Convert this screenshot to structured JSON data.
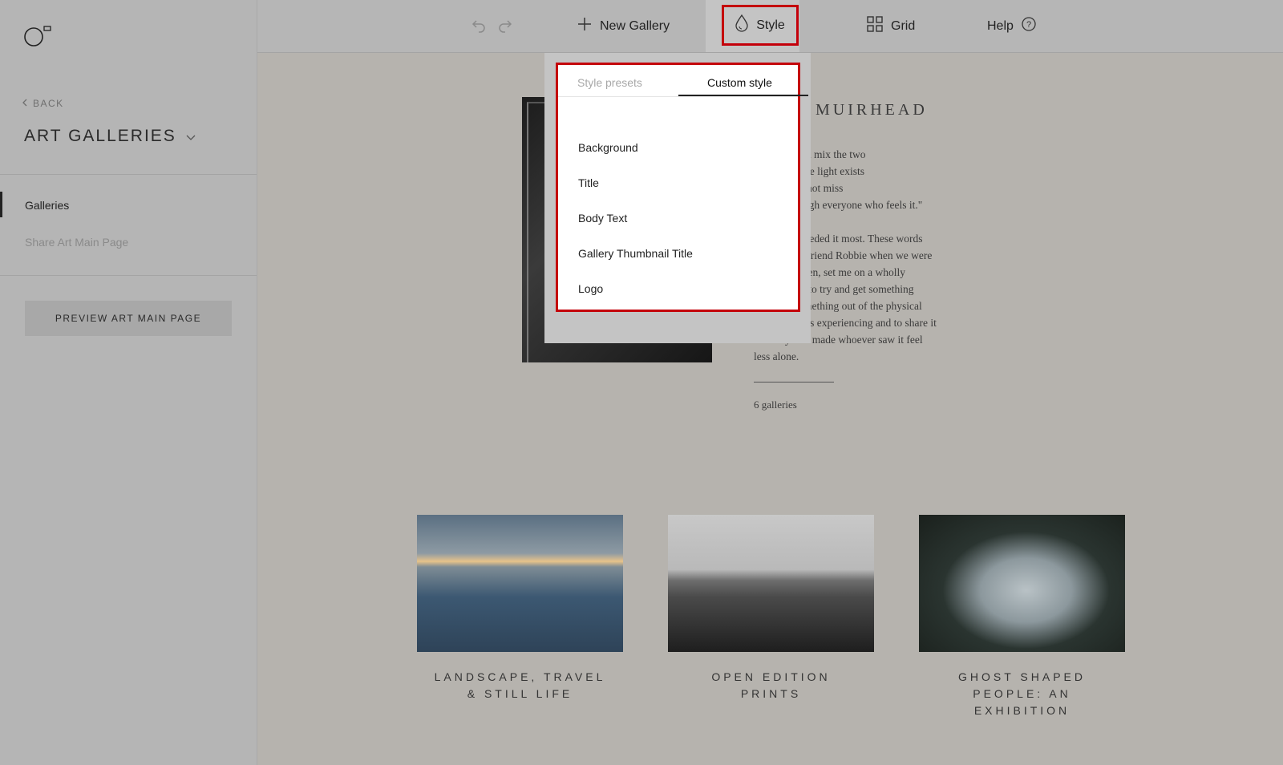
{
  "sidebar": {
    "back_label": "BACK",
    "site_title": "ART GALLERIES",
    "nav": [
      "Galleries",
      "Share Art Main Page"
    ],
    "preview_button": "PREVIEW ART MAIN PAGE"
  },
  "toolbar": {
    "new_gallery": "New Gallery",
    "style": "Style",
    "grid": "Grid",
    "help": "Help"
  },
  "style_panel": {
    "tabs": [
      "Style presets",
      "Custom style"
    ],
    "active_tab": "Custom style",
    "items": [
      "Background",
      "Title",
      "Body Text",
      "Gallery Thumbnail Title",
      "Logo"
    ]
  },
  "page": {
    "author_partial": "MUIRHEAD",
    "paragraph1": [
      "ll in how you mix the two",
      "just where the light exists",
      "that you cannot miss",
      "s a hole though everyone who feels it.\""
    ],
    "paragraph2": [
      "ne when I needed it most. These words",
      "sung by my friend Robbie when we were",
      "e than children, set me on a wholly",
      "path. A path to try and get something",
      "To make something out of the physical",
      "nal pain I was experiencing and to share it",
      "in a way that made whoever saw it feel",
      "less alone."
    ],
    "gallery_count": "6 galleries",
    "galleries": [
      {
        "title_lines": [
          "LANDSCAPE, TRAVEL",
          "& STILL LIFE"
        ]
      },
      {
        "title_lines": [
          "OPEN EDITION",
          "PRINTS"
        ]
      },
      {
        "title_lines": [
          "GHOST SHAPED",
          "PEOPLE: AN",
          "EXHIBITION"
        ]
      }
    ]
  },
  "colors": {
    "highlight": "#c4000a",
    "sidebar_bg": "#b5b5b5",
    "canvas_bg": "#b6b3ae"
  }
}
